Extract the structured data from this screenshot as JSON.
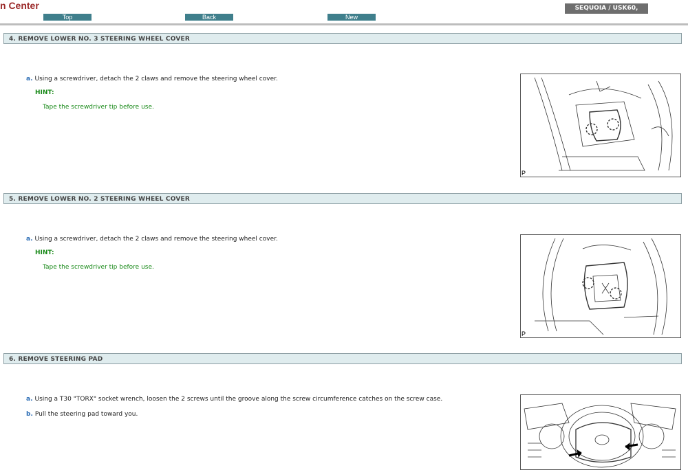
{
  "header": {
    "brand": "n Center",
    "nav": [
      "Top",
      "Back",
      "New"
    ],
    "model": "SEQUOIA / USK60,"
  },
  "sections": [
    {
      "title": "4. REMOVE LOWER NO. 3 STEERING WHEEL COVER",
      "steps": [
        {
          "letter": "a.",
          "text": "Using a screwdriver, detach the 2 claws and remove the steering wheel cover."
        }
      ],
      "hint_label": "HINT:",
      "hint_text": "Tape the screwdriver tip before use.",
      "figure_label": "P"
    },
    {
      "title": "5. REMOVE LOWER NO. 2 STEERING WHEEL COVER",
      "steps": [
        {
          "letter": "a.",
          "text": "Using a screwdriver, detach the 2 claws and remove the steering wheel cover."
        }
      ],
      "hint_label": "HINT:",
      "hint_text": "Tape the screwdriver tip before use.",
      "figure_label": "P"
    },
    {
      "title": "6. REMOVE STEERING PAD",
      "steps": [
        {
          "letter": "a.",
          "text": "Using a T30 \"TORX\" socket wrench, loosen the 2 screws until the groove along the screw circumference catches on the screw case."
        },
        {
          "letter": "b.",
          "text": "Pull the steering pad toward you."
        }
      ]
    }
  ]
}
